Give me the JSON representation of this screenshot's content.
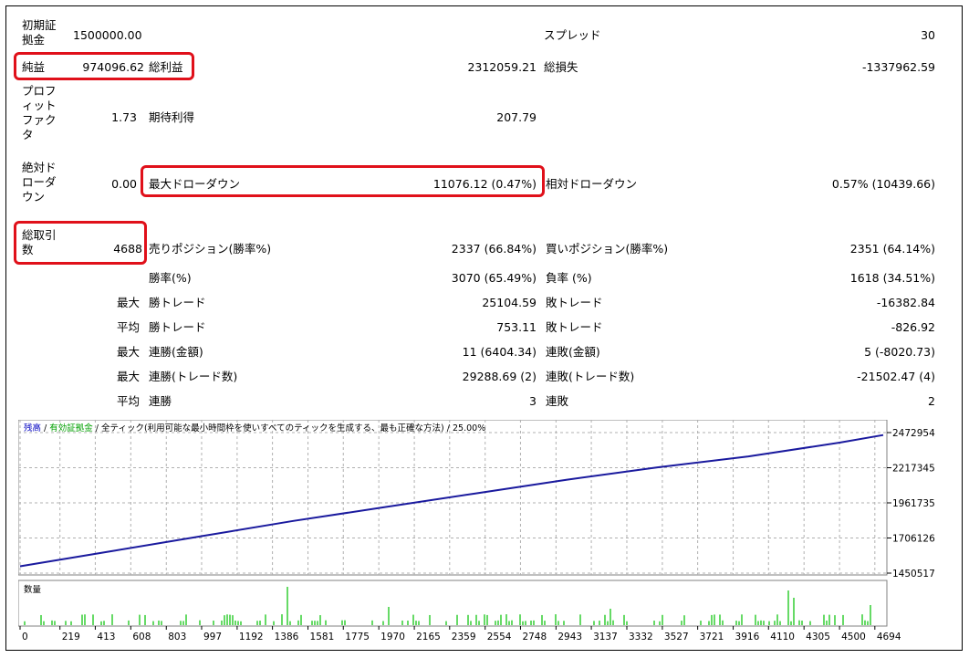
{
  "report": {
    "initial_deposit": {
      "label": "初期証拠金",
      "value": "1500000.00"
    },
    "spread": {
      "label": "スプレッド",
      "value": "30"
    },
    "net_profit": {
      "label": "純益",
      "value": "974096.62"
    },
    "gross_profit": {
      "label": "総利益",
      "value": "2312059.21"
    },
    "gross_loss": {
      "label": "総損失",
      "value": "-1337962.59"
    },
    "profit_factor": {
      "label": "プロフィットファクタ",
      "value": "1.73"
    },
    "expected_payoff": {
      "label": "期待利得",
      "value": "207.79"
    },
    "abs_drawdown": {
      "label": "絶対ドローダウン",
      "value": "0.00"
    },
    "max_drawdown": {
      "label": "最大ドローダウン",
      "value": "11076.12 (0.47%)"
    },
    "rel_drawdown": {
      "label": "相対ドローダウン",
      "value": "0.57% (10439.66)"
    },
    "total_trades": {
      "label": "総取引数",
      "value": "4688"
    },
    "short_positions": {
      "label": "売りポジション(勝率%)",
      "value": "2337 (66.84%)"
    },
    "long_positions": {
      "label": "買いポジション(勝率%)",
      "value": "2351 (64.14%)"
    },
    "win_rate": {
      "label": "勝率(%)",
      "value": "3070 (65.49%)"
    },
    "loss_rate": {
      "label": "負率 (%)",
      "value": "1618 (34.51%)"
    },
    "largest": {
      "prefix": "最大",
      "win_label": "勝トレード",
      "win_value": "25104.59",
      "loss_label": "敗トレード",
      "loss_value": "-16382.84"
    },
    "average": {
      "prefix": "平均",
      "win_label": "勝トレード",
      "win_value": "753.11",
      "loss_label": "敗トレード",
      "loss_value": "-826.92"
    },
    "max_consec_amount": {
      "prefix": "最大",
      "win_label": "連勝(金額)",
      "win_value": "11 (6404.34)",
      "loss_label": "連敗(金額)",
      "loss_value": "5 (-8020.73)"
    },
    "max_consec_trades": {
      "prefix": "最大",
      "win_label": "連勝(トレード数)",
      "win_value": "29288.69 (2)",
      "loss_label": "連敗(トレード数)",
      "loss_value": "-21502.47 (4)"
    },
    "avg_consec": {
      "prefix": "平均",
      "win_label": "連勝",
      "win_value": "3",
      "loss_label": "連敗",
      "loss_value": "2"
    }
  },
  "chart_data": {
    "type": "line",
    "header": {
      "balance_label": "残高",
      "sep1": " / ",
      "equity_label": "有効証拠金",
      "sep2": " / ",
      "model_text": "全ティック(利用可能な最小時間枠を使いすべてのティックを生成する、最も正確な方法) / 25.00%"
    },
    "volume_label": "数量",
    "y_ticks": [
      2472954,
      2217345,
      1961735,
      1706126,
      1450517
    ],
    "ylim": [
      1450517,
      2472954
    ],
    "x_ticks": [
      0,
      219,
      413,
      608,
      803,
      997,
      1192,
      1386,
      1581,
      1775,
      1970,
      2165,
      2359,
      2554,
      2748,
      2943,
      3137,
      3332,
      3527,
      3721,
      3916,
      4110,
      4305,
      4500,
      4694
    ],
    "xlim": [
      0,
      4740
    ],
    "series": [
      {
        "x": [
          0,
          500,
          1000,
          1500,
          2000,
          2500,
          3000,
          3500,
          4000,
          4500,
          4740
        ],
        "y": [
          1500000,
          1610000,
          1720000,
          1830000,
          1930000,
          2030000,
          2130000,
          2220000,
          2300000,
          2400000,
          2455000
        ]
      }
    ],
    "colors": {
      "balance": "#1a1a9e",
      "equity": "#1a1a9e",
      "volume": "#00c000",
      "header_balance": "#0000c0",
      "header_equity": "#00a000"
    }
  }
}
